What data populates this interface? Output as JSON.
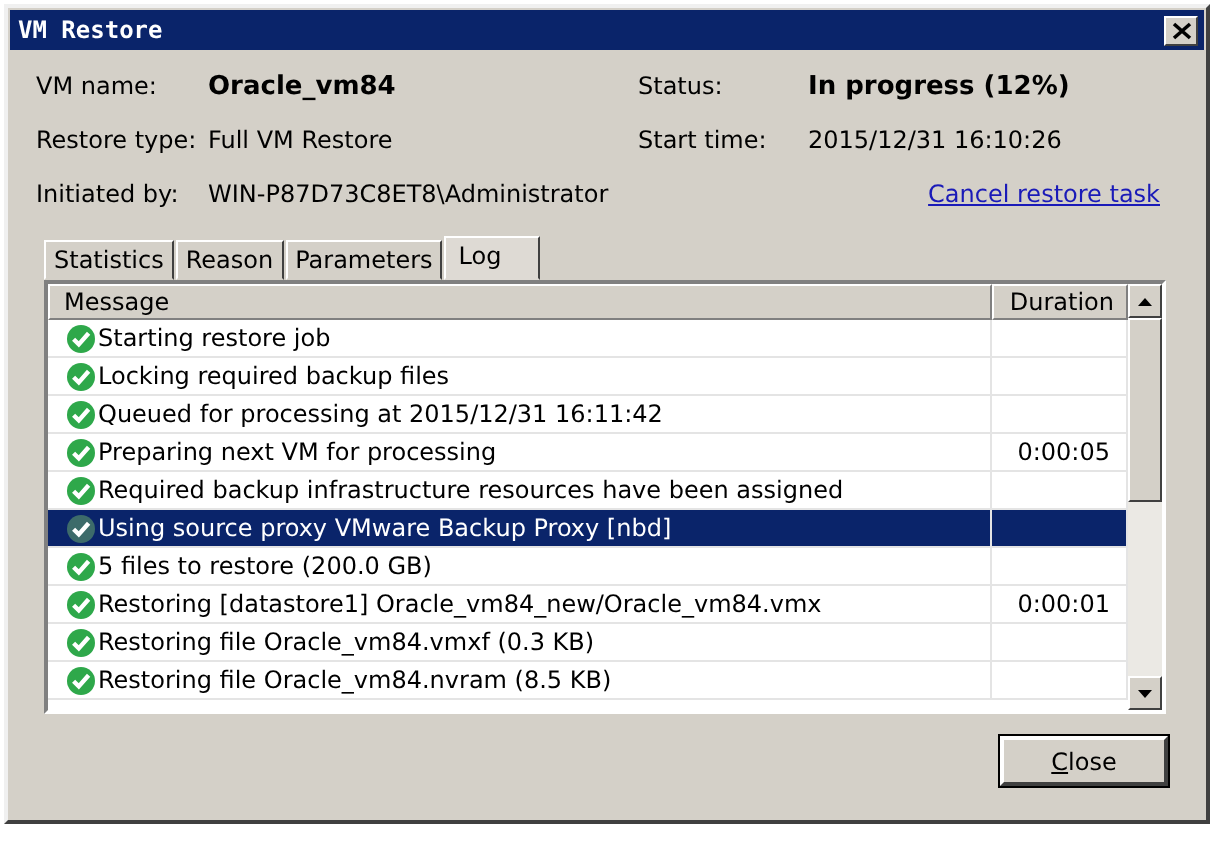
{
  "window": {
    "title": "VM Restore"
  },
  "info": [
    {
      "label": "VM name:",
      "value": "Oracle_vm84",
      "bold": true
    },
    {
      "label": "Status:",
      "value": "In progress (12%)",
      "bold": true
    },
    {
      "label": "Restore type:",
      "value": "Full VM Restore",
      "bold": false
    },
    {
      "label": "Start time:",
      "value": "2015/12/31 16:10:26",
      "bold": false
    },
    {
      "label": "Initiated by:",
      "value": "WIN-P87D73C8ET8\\Administrator",
      "bold": false
    }
  ],
  "cancel_link": "Cancel restore task",
  "tabs": [
    {
      "label": "Statistics",
      "selected": false
    },
    {
      "label": "Reason",
      "selected": false
    },
    {
      "label": "Parameters",
      "selected": false
    },
    {
      "label": "Log",
      "selected": true
    }
  ],
  "log": {
    "columns": [
      "Message",
      "Duration"
    ],
    "rows": [
      {
        "message": "Starting restore job",
        "duration": "",
        "selected": false
      },
      {
        "message": "Locking required backup files",
        "duration": "",
        "selected": false
      },
      {
        "message": "Queued for processing at 2015/12/31 16:11:42",
        "duration": "",
        "selected": false
      },
      {
        "message": "Preparing next VM for processing",
        "duration": "0:00:05",
        "selected": false
      },
      {
        "message": "Required backup infrastructure resources have been assigned",
        "duration": "",
        "selected": false
      },
      {
        "message": "Using source proxy VMware Backup Proxy [nbd]",
        "duration": "",
        "selected": true
      },
      {
        "message": "5 files to restore (200.0 GB)",
        "duration": "",
        "selected": false
      },
      {
        "message": "Restoring [datastore1] Oracle_vm84_new/Oracle_vm84.vmx",
        "duration": "0:00:01",
        "selected": false
      },
      {
        "message": "Restoring file Oracle_vm84.vmxf (0.3 KB)",
        "duration": "",
        "selected": false
      },
      {
        "message": "Restoring file Oracle_vm84.nvram (8.5 KB)",
        "duration": "",
        "selected": false
      }
    ]
  },
  "buttons": [
    "Close"
  ]
}
